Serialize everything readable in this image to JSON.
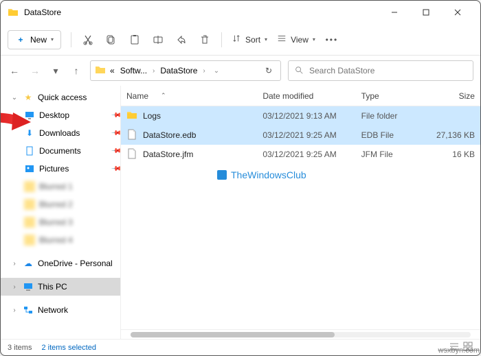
{
  "window": {
    "title": "DataStore"
  },
  "toolbar": {
    "new_label": "New",
    "sort_label": "Sort",
    "view_label": "View"
  },
  "breadcrumbs": {
    "seg1": "Softw...",
    "seg2": "DataStore"
  },
  "search": {
    "placeholder": "Search DataStore"
  },
  "sidebar": {
    "quick": "Quick access",
    "desktop": "Desktop",
    "downloads": "Downloads",
    "documents": "Documents",
    "pictures": "Pictures",
    "onedrive": "OneDrive - Personal",
    "thispc": "This PC",
    "network": "Network",
    "b1": "Blurred 1",
    "b2": "Blurred 2",
    "b3": "Blurred 3",
    "b4": "Blurred 4"
  },
  "columns": {
    "name": "Name",
    "date": "Date modified",
    "type": "Type",
    "size": "Size"
  },
  "rows": [
    {
      "name": "Logs",
      "date": "03/12/2021 9:13 AM",
      "type": "File folder",
      "size": "",
      "icon": "folder",
      "selected": true
    },
    {
      "name": "DataStore.edb",
      "date": "03/12/2021 9:25 AM",
      "type": "EDB File",
      "size": "27,136 KB",
      "icon": "file",
      "selected": true
    },
    {
      "name": "DataStore.jfm",
      "date": "03/12/2021 9:25 AM",
      "type": "JFM File",
      "size": "16 KB",
      "icon": "file",
      "selected": false
    }
  ],
  "watermark": "TheWindowsClub",
  "status": {
    "items": "3 items",
    "selected": "2 items selected"
  },
  "corner": "wsxbyn.com"
}
